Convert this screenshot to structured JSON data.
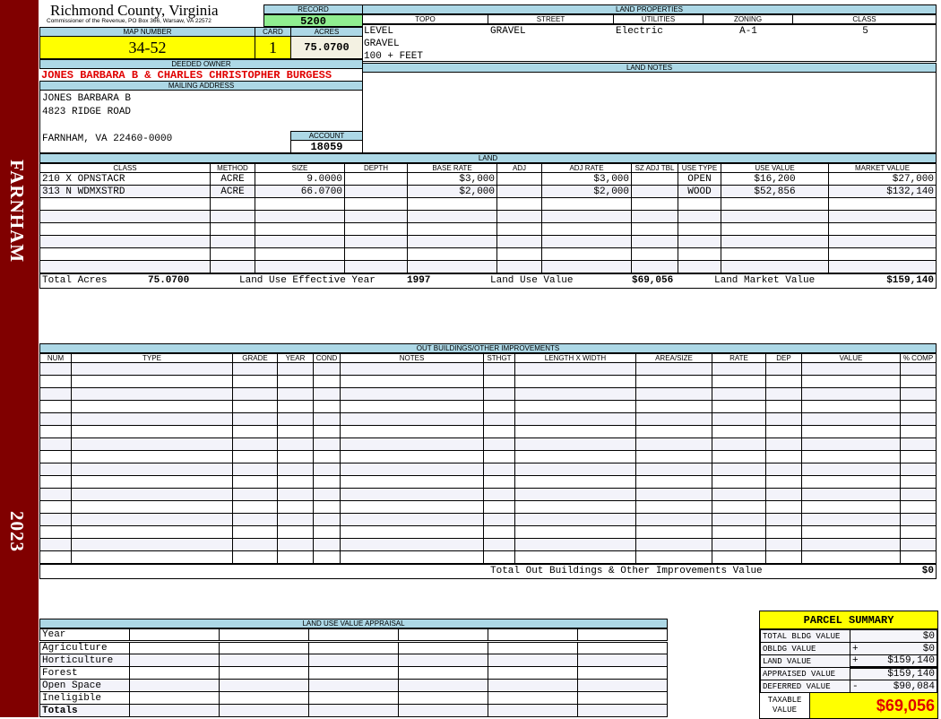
{
  "sidebar": {
    "district": "FARNHAM",
    "year": "2023",
    "color": "#800000"
  },
  "header": {
    "county": "Richmond County, Virginia",
    "office": "Commissioner of the Revenue, PO Box 366, Warsaw, VA 22572"
  },
  "record": {
    "label": "RECORD",
    "value": "5200"
  },
  "map": {
    "map_label": "MAP NUMBER",
    "map_value": "34-52",
    "card_label": "CARD",
    "card_value": "1",
    "acres_label": "ACRES",
    "acres_value": "75.0700"
  },
  "owner": {
    "label": "DEEDED OWNER",
    "name": "JONES BARBARA B & CHARLES CHRISTOPHER BURGESS"
  },
  "mailing": {
    "label": "MAILING ADDRESS",
    "lines": [
      "JONES BARBARA B",
      "4823 RIDGE ROAD",
      "",
      "FARNHAM, VA 22460-0000"
    ]
  },
  "account": {
    "label": "ACCOUNT",
    "value": "18059"
  },
  "land_properties": {
    "label": "LAND PROPERTIES",
    "headers": [
      "TOPO",
      "STREET",
      "UTILITIES",
      "ZONING",
      "CLASS"
    ],
    "topo": [
      "LEVEL",
      "GRAVEL",
      "100 + FEET"
    ],
    "street": "GRAVEL",
    "utilities": "Electric",
    "zoning": "A-1",
    "class": "5"
  },
  "land_notes": {
    "label": "LAND NOTES"
  },
  "land": {
    "label": "LAND",
    "headers": [
      "CLASS",
      "METHOD",
      "SIZE",
      "DEPTH",
      "BASE RATE",
      "ADJ",
      "ADJ RATE",
      "SZ ADJ TBL",
      "USE TYPE",
      "USE VALUE",
      "MARKET VALUE"
    ],
    "rows": [
      [
        "210 X OPNSTACR",
        "ACRE",
        "9.0000",
        "",
        "$3,000",
        "",
        "$3,000",
        "",
        "OPEN",
        "$16,200",
        "$27,000"
      ],
      [
        "313 N WDMXSTRD",
        "ACRE",
        "66.0700",
        "",
        "$2,000",
        "",
        "$2,000",
        "",
        "WOOD",
        "$52,856",
        "$132,140"
      ]
    ],
    "totals": {
      "acres_label": "Total Acres",
      "acres": "75.0700",
      "year_label": "Land Use Effective Year",
      "year": "1997",
      "use_label": "Land Use Value",
      "use": "$69,056",
      "market_label": "Land Market Value",
      "market": "$159,140"
    }
  },
  "outbuildings": {
    "label": "OUT BUILDINGS/OTHER IMPROVEMENTS",
    "headers": [
      "NUM",
      "TYPE",
      "GRADE",
      "YEAR",
      "COND",
      "NOTES",
      "STHGT",
      "LENGTH X WIDTH",
      "AREA/SIZE",
      "RATE",
      "DEP",
      "VALUE",
      "% COMP"
    ],
    "total_label": "Total Out Buildings & Other Improvements Value",
    "total": "$0"
  },
  "land_use": {
    "label": "LAND USE VALUE APPRAISAL",
    "year_label": "Year",
    "rows": [
      "Agriculture",
      "Horticulture",
      "Forest",
      "Open Space",
      "Ineligible"
    ],
    "totals_label": "Totals"
  },
  "summary": {
    "title": "PARCEL SUMMARY",
    "rows": [
      {
        "label": "TOTAL BLDG VALUE",
        "op": "",
        "value": "$0"
      },
      {
        "label": "OBLDG VALUE",
        "op": "+",
        "value": "$0"
      },
      {
        "label": "LAND VALUE",
        "op": "+",
        "value": "$159,140"
      },
      {
        "label": "APPRAISED VALUE",
        "op": "",
        "value": "$159,140"
      },
      {
        "label": "DEFERRED VALUE",
        "op": "-",
        "value": "$90,084"
      }
    ],
    "taxable_label": "TAXABLE VALUE",
    "taxable": "$69,056"
  }
}
